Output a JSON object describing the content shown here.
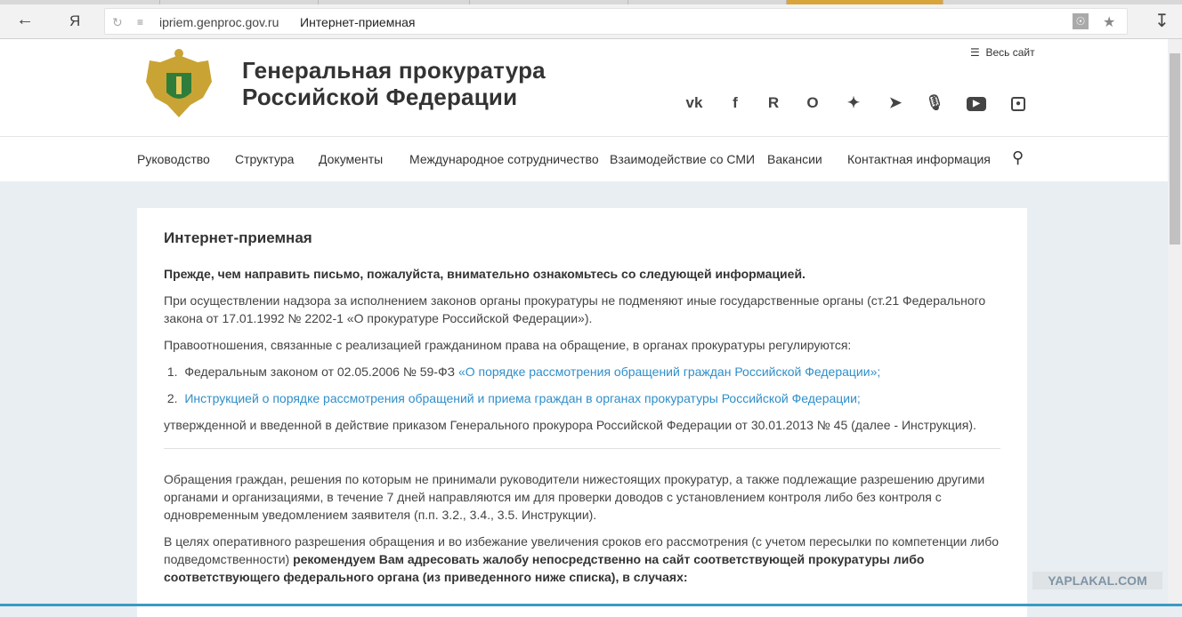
{
  "browser": {
    "url_host": "ipriem.genproc.gov.ru",
    "page_title": "Интернет-приемная",
    "yandex": "Я"
  },
  "header": {
    "title_line1": "Генеральная прокуратура",
    "title_line2": "Российской Федерации",
    "whole_site": "Весь сайт",
    "social": [
      "vk",
      "facebook",
      "rutube",
      "odnoklassniki",
      "twitter",
      "telegram",
      "podcast",
      "youtube",
      "instagram"
    ]
  },
  "nav": [
    "Руководство",
    "Структура",
    "Документы",
    "Международное сотрудничество",
    "Взаимодействие со СМИ",
    "Вакансии",
    "Контактная информация"
  ],
  "content": {
    "title": "Интернет-приемная",
    "intro": "Прежде, чем направить письмо, пожалуйста, внимательно ознакомьтесь со следующей информацией.",
    "p1": "При осуществлении надзора за исполнением законов органы прокуратуры не подменяют иные государственные органы (ст.21 Федерального закона от 17.01.1992 № 2202-1 «О прокуратуре Российской Федерации»).",
    "p2": "Правоотношения, связанные с реализацией гражданином права на обращение, в органах прокуратуры регулируются:",
    "li1_text": "Федеральным законом от 02.05.2006 № 59-ФЗ ",
    "li1_link": "«О порядке рассмотрения обращений граждан Российской Федерации»;",
    "li2_link": "Инструкцией о порядке рассмотрения обращений и приема граждан в органах прокуратуры Российской Федерации;",
    "p3": "утвержденной и введенной в действие приказом Генерального прокурора Российской Федерации от 30.01.2013 № 45 (далее - Инструкция).",
    "p4": "Обращения граждан, решения по которым не принимали руководители нижестоящих прокуратур, а также подлежащие разрешению другими органами и организациями, в течение 7 дней направляются им для проверки доводов с установлением контроля либо без контроля с одновременным уведомлением заявителя (п.п. 3.2., 3.4., 3.5. Инструкции).",
    "p5_a": "В целях оперативного разрешения обращения и во избежание увеличения сроков его рассмотрения (с учетом пересылки по компетенции либо подведомственности) ",
    "p5_b": "рекомендуем Вам адресовать жалобу непосредственно на сайт соответствующей прокуратуры либо соответствующего федерального органа (из приведенного ниже списка), в случаях:"
  },
  "watermark": "YAPLAKAL.COM"
}
